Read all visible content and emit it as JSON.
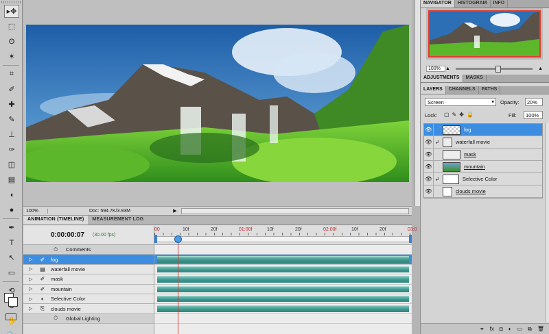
{
  "tools": [
    "move-icon",
    "marquee-icon",
    "lasso-icon",
    "magic-wand-icon",
    "crop-icon",
    "eyedropper-icon",
    "healing-icon",
    "brush-icon",
    "stamp-icon",
    "history-brush-icon",
    "eraser-icon",
    "gradient-icon",
    "blur-icon",
    "dodge-icon",
    "pen-icon",
    "type-icon",
    "path-select-icon",
    "shape-icon",
    "3d-rotate-icon",
    "3d-orbit-icon",
    "hand-icon",
    "zoom-icon"
  ],
  "tool_glyphs": [
    "▸✥",
    "⬚",
    "ʘ",
    "✶",
    "⌗",
    "✐",
    "✚",
    "✎",
    "⊥",
    "✑",
    "◫",
    "▤",
    "◖",
    "●",
    "✒",
    "T",
    "↖",
    "▭",
    "⟲",
    "⊚",
    "✋",
    "🔍"
  ],
  "doc": {
    "zoom": "100%",
    "info": "Doc: 594.7K/3.93M"
  },
  "animation": {
    "tabs": [
      "ANIMATION (TIMELINE)",
      "MEASUREMENT LOG"
    ],
    "timecode": "0:00:00:07",
    "fps": "(30.00 fps)",
    "ruler_labels": [
      "00",
      "10f",
      "20f",
      "01:00f",
      "10f",
      "20f",
      "02:00f",
      "10f",
      "20f",
      "03:0"
    ],
    "rows": [
      {
        "name": "Comments",
        "kind": "comment"
      },
      {
        "name": "fog",
        "kind": "layer",
        "icon": "brush",
        "selected": true
      },
      {
        "name": "waterfall movie",
        "kind": "layer",
        "icon": "film"
      },
      {
        "name": "mask",
        "kind": "layer",
        "icon": "brush"
      },
      {
        "name": "mountain",
        "kind": "layer",
        "icon": "brush"
      },
      {
        "name": "Selective Color",
        "kind": "layer",
        "icon": "adjust"
      },
      {
        "name": "clouds movie",
        "kind": "layer",
        "icon": "doc"
      },
      {
        "name": "Global Lighting",
        "kind": "comment"
      }
    ],
    "playhead_frame": 7
  },
  "navigator": {
    "tabs": [
      "NAVIGATOR",
      "HISTOGRAM",
      "INFO"
    ],
    "zoom": "100%"
  },
  "adjustments": {
    "tabs": [
      "ADJUSTMENTS",
      "MASKS"
    ]
  },
  "layers": {
    "tabs": [
      "LAYERS",
      "CHANNELS",
      "PATHS"
    ],
    "blend_mode": "Screen",
    "opacity_label": "Opacity:",
    "opacity": "20%",
    "lock_label": "Lock:",
    "fill_label": "Fill:",
    "fill": "100%",
    "items": [
      {
        "name": "fog",
        "thumb": "check",
        "selected": true
      },
      {
        "name": "waterfall movie",
        "thumb": "film"
      },
      {
        "name": "mask",
        "thumb": "mask",
        "underline": true
      },
      {
        "name": "mountain",
        "thumb": "land",
        "underline": true
      },
      {
        "name": "Selective Color",
        "thumb": "white"
      },
      {
        "name": "clouds movie",
        "thumb": "doc",
        "underline": true
      }
    ]
  },
  "colors": {
    "selection": "#3d8ee0",
    "track": "#3d9a91",
    "playhead": "#d23a3a"
  }
}
